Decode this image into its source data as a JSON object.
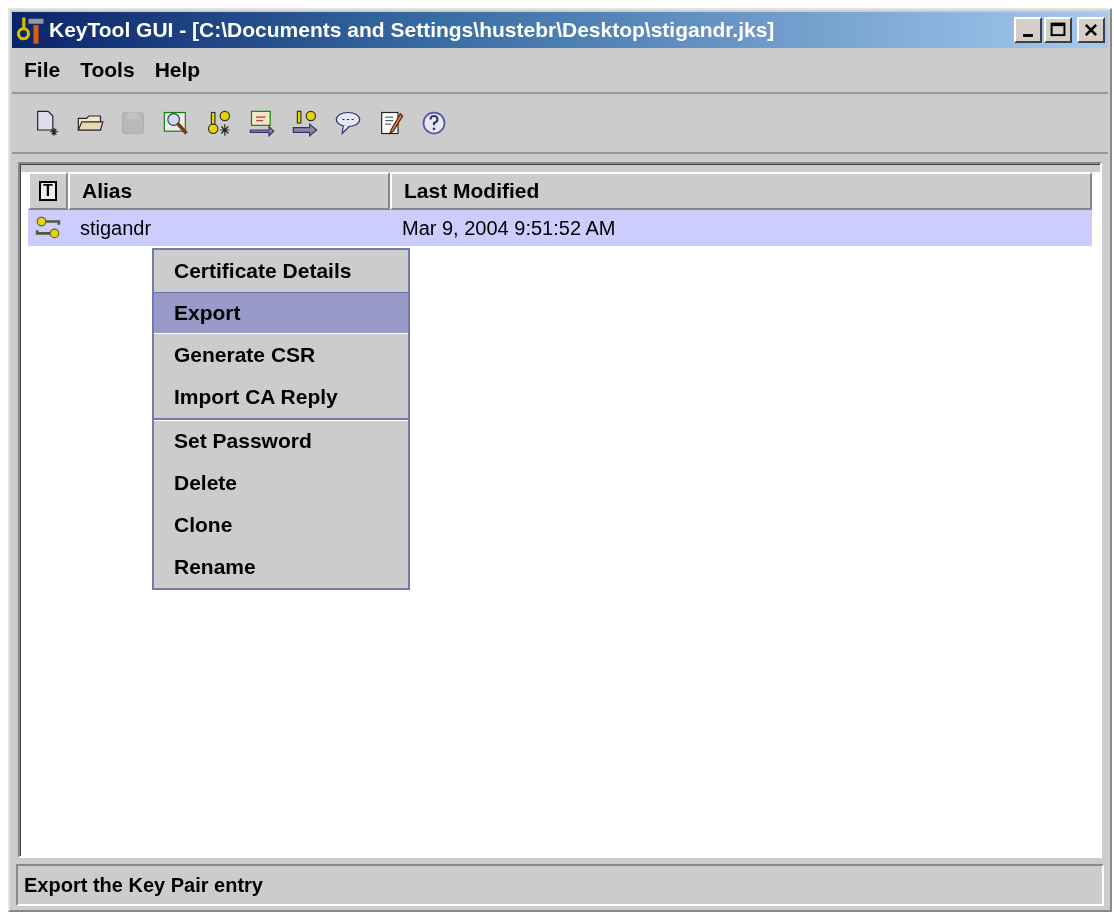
{
  "window": {
    "title": "KeyTool GUI - [C:\\Documents and Settings\\hustebr\\Desktop\\stigandr.jks]"
  },
  "menu_bar": [
    {
      "label": "File"
    },
    {
      "label": "Tools"
    },
    {
      "label": "Help"
    }
  ],
  "toolbar": [
    {
      "kind": "new",
      "disabled": false
    },
    {
      "kind": "open",
      "disabled": false
    },
    {
      "kind": "save",
      "disabled": true
    },
    {
      "kind": "examine",
      "disabled": false
    },
    {
      "kind": "genkey",
      "disabled": false
    },
    {
      "kind": "importcert",
      "disabled": false
    },
    {
      "kind": "importkey",
      "disabled": false
    },
    {
      "kind": "chat",
      "disabled": false
    },
    {
      "kind": "edit",
      "disabled": false
    },
    {
      "kind": "help",
      "disabled": false
    }
  ],
  "table": {
    "columns": [
      {
        "label": "T"
      },
      {
        "label": "Alias"
      },
      {
        "label": "Last Modified"
      }
    ],
    "rows": [
      {
        "alias": "stigandr",
        "last_modified": "Mar 9, 2004 9:51:52 AM",
        "selected": true
      }
    ]
  },
  "context_menu": [
    [
      {
        "label": "Certificate Details",
        "selected": false
      },
      {
        "label": "Export",
        "selected": true
      },
      {
        "label": "Generate CSR",
        "selected": false
      },
      {
        "label": "Import CA Reply",
        "selected": false
      }
    ],
    [
      {
        "label": "Set Password",
        "selected": false
      },
      {
        "label": "Delete",
        "selected": false
      },
      {
        "label": "Clone",
        "selected": false
      },
      {
        "label": "Rename",
        "selected": false
      }
    ]
  ],
  "status_bar": "Export the Key Pair entry"
}
